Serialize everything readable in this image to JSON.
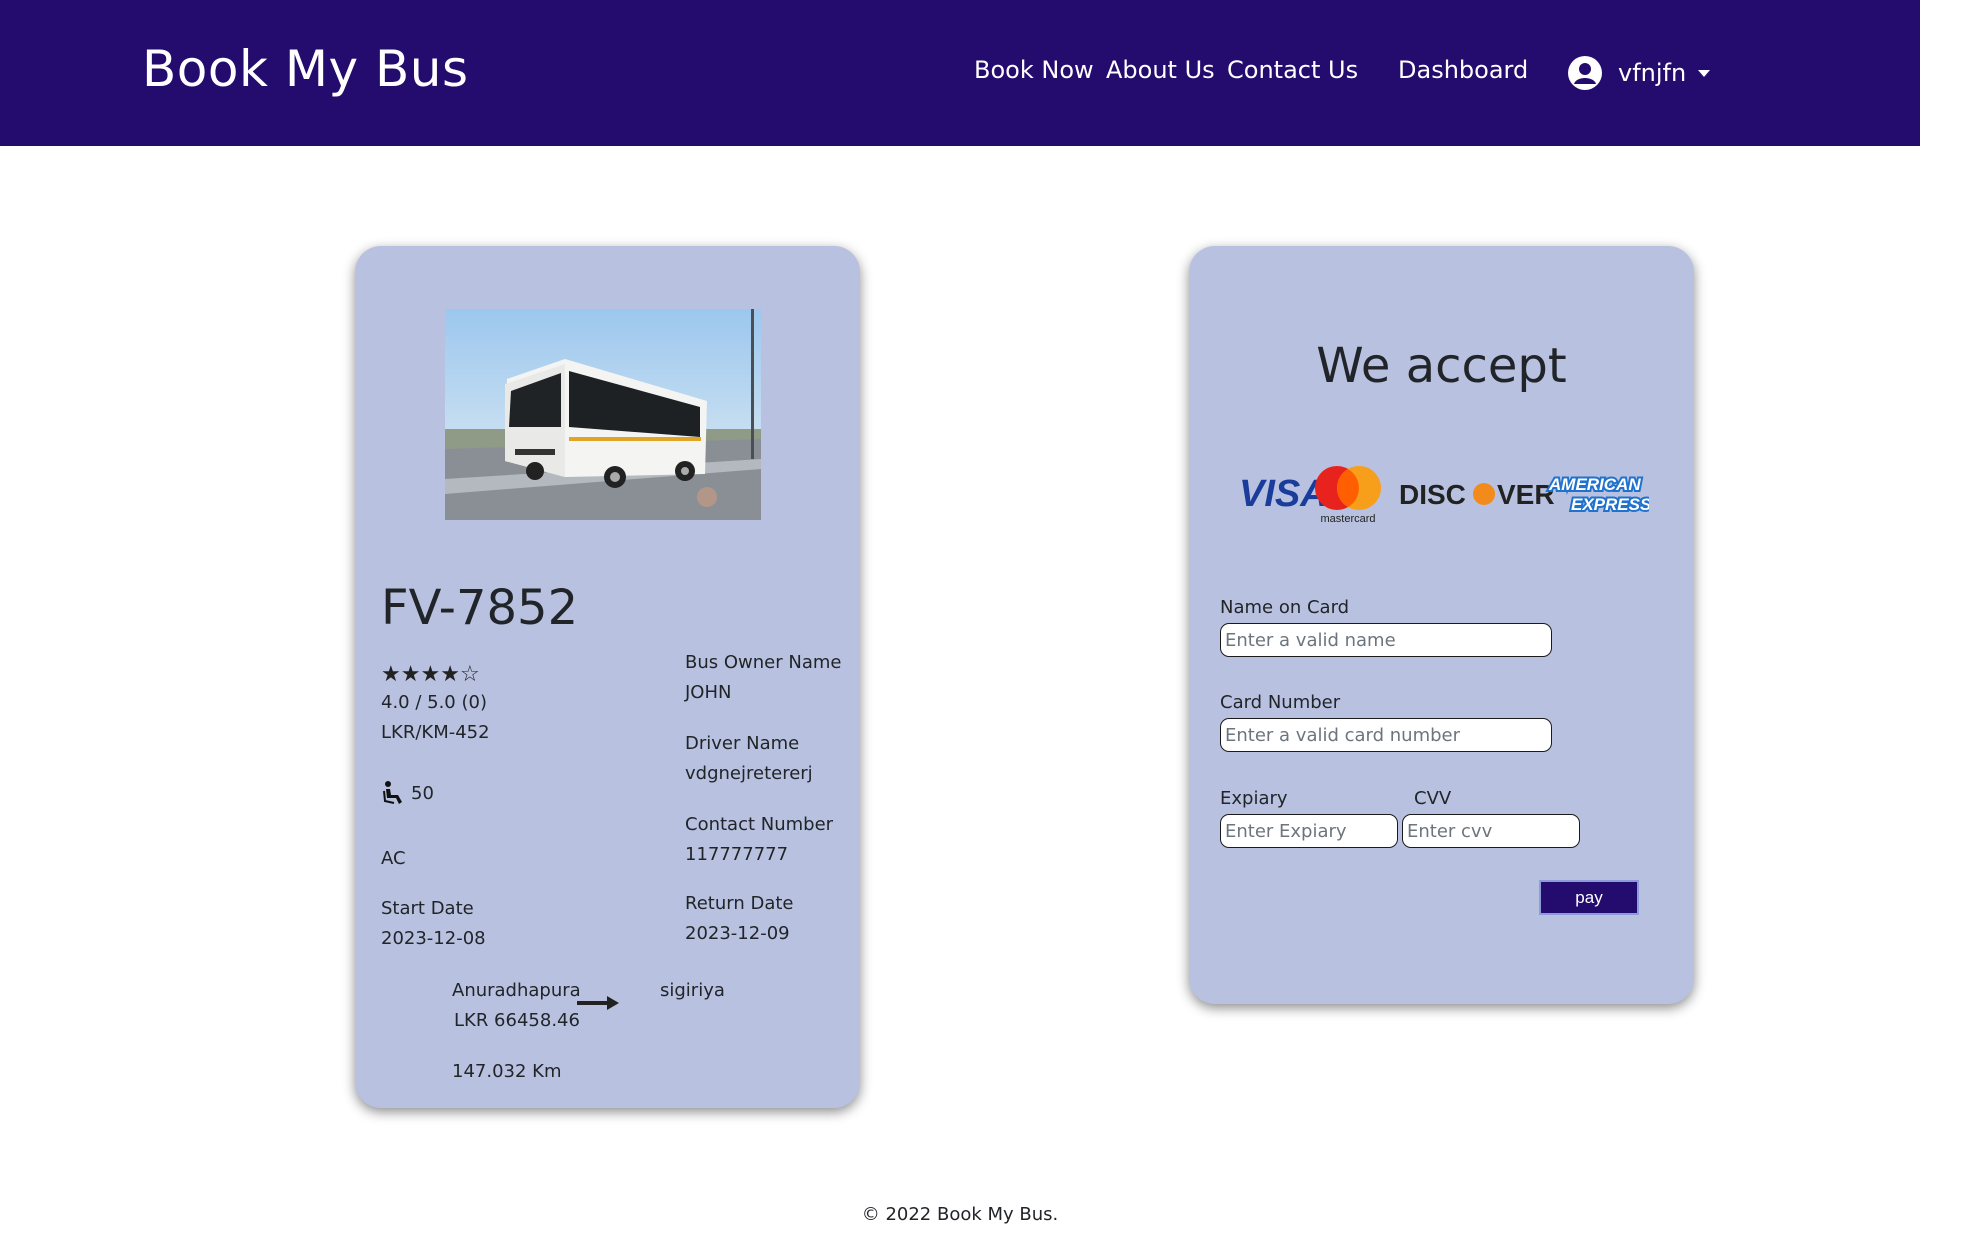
{
  "navbar": {
    "brand": "Book My Bus",
    "links": [
      "Book Now",
      "About Us",
      "Contact Us",
      "Dashboard"
    ],
    "username": "vfnjfn",
    "background": "#240b6e"
  },
  "bus": {
    "number": "FV-7852",
    "rating_stars": 4,
    "rating_text": "4.0 / 5.0 (0)",
    "rate": "LKR/KM-452",
    "seats": "50",
    "type": "AC",
    "start_date_label": "Start Date",
    "start_date": "2023-12-08",
    "owner_label": "Bus Owner Name",
    "owner": "JOHN",
    "driver_label": "Driver Name",
    "driver": "vdgnejretererj",
    "contact_label": "Contact Number",
    "contact": "117777777",
    "return_date_label": "Return Date",
    "return_date": "2023-12-09",
    "from": "Anuradhapura",
    "to": "sigiriya",
    "price": "LKR 66458.46",
    "distance": "147.032 Km"
  },
  "payment": {
    "title": "We accept",
    "card_brands": [
      "VISA",
      "mastercard",
      "DISCOVER",
      "AMERICAN EXPRESS"
    ],
    "name_label": "Name on Card",
    "name_placeholder": "Enter a valid name",
    "number_label": "Card Number",
    "number_placeholder": "Enter a valid card number",
    "expiry_label": "Expiary",
    "expiry_placeholder": "Enter Expiary",
    "cvv_label": "CVV",
    "cvv_placeholder": "Enter cvv",
    "pay_label": "pay"
  },
  "footer": {
    "text": "© 2022 Book My Bus."
  }
}
